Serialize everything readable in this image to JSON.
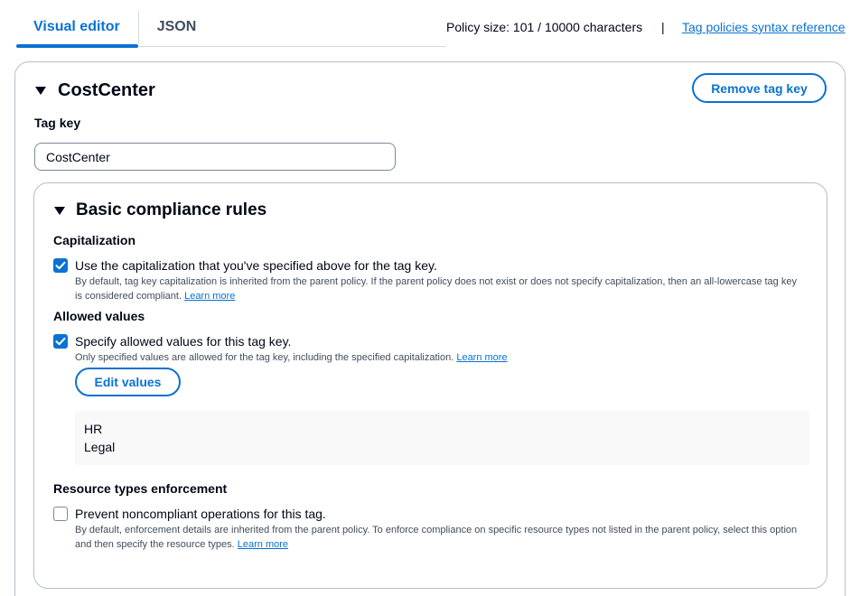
{
  "tabs": [
    {
      "label": "Visual editor",
      "active": true
    },
    {
      "label": "JSON",
      "active": false
    }
  ],
  "policy_size": "Policy size: 101 / 10000 characters",
  "separator": "|",
  "syntax_link": "Tag policies syntax reference",
  "tag": {
    "title": "CostCenter",
    "remove_label": "Remove tag key",
    "key_label": "Tag key",
    "key_value": "CostCenter"
  },
  "compliance": {
    "title": "Basic compliance rules",
    "capitalization": {
      "label": "Capitalization",
      "checkbox_label": "Use the capitalization that you've specified above for the tag key.",
      "checked": true,
      "description": "By default, tag key capitalization is inherited from the parent policy. If the parent policy does not exist or does not specify capitalization, then an all-lowercase tag key is considered compliant.",
      "learn_more": "Learn more"
    },
    "allowed_values": {
      "label": "Allowed values",
      "checkbox_label": "Specify allowed values for this tag key.",
      "checked": true,
      "description": "Only specified values are allowed for the tag key, including the specified capitalization.",
      "learn_more": "Learn more",
      "edit_label": "Edit values",
      "values": [
        "HR",
        "Legal"
      ]
    },
    "enforcement": {
      "label": "Resource types enforcement",
      "checkbox_label": "Prevent noncompliant operations for this tag.",
      "checked": false,
      "description": "By default, enforcement details are inherited from the parent policy. To enforce compliance on specific resource types not listed in the parent policy, select this option and then specify the resource types.",
      "learn_more": "Learn more"
    }
  },
  "colors": {
    "accent": "#0972d3",
    "text": "#000716",
    "border": "#b6bec9"
  }
}
